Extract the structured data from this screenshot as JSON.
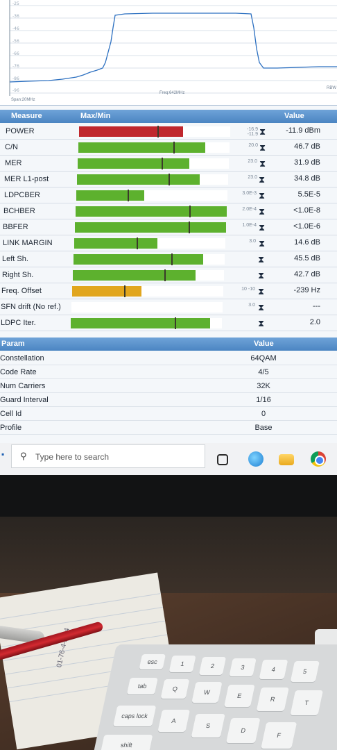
{
  "spectrum": {
    "db_ticks": [
      "-25",
      "-36",
      "-46",
      "-56",
      "-66",
      "-76",
      "-86",
      "-96"
    ],
    "span": "Span:20MHz",
    "freq": "Freq:642MHz",
    "rbw": "RBW"
  },
  "measure_header": {
    "measure": "Measure",
    "maxmin": "Max/Min",
    "value": "Value"
  },
  "measurements": [
    {
      "label": "POWER",
      "threshold": "-16.9\n-11.9",
      "value": "-11.9 dBm",
      "fill": 0.69,
      "color": "#c0272d",
      "color_name": "red"
    },
    {
      "label": "C/N",
      "threshold": "20.0",
      "value": "46.7 dB",
      "fill": 0.84,
      "color": "#5db12e",
      "color_name": "green"
    },
    {
      "label": "MER",
      "threshold": "23.0",
      "value": "31.9 dB",
      "fill": 0.74,
      "color": "#5db12e",
      "color_name": "green"
    },
    {
      "label": "MER L1-post",
      "threshold": "23.0",
      "value": "34.8 dB",
      "fill": 0.81,
      "color": "#5db12e",
      "color_name": "green"
    },
    {
      "label": "LDPCBER",
      "threshold": "3.0E-3",
      "value": "5.5E-5",
      "fill": 0.45,
      "color": "#5db12e",
      "color_name": "green"
    },
    {
      "label": "BCHBER",
      "threshold": "2.0E-4",
      "value": "<1.0E-8",
      "fill": 1.0,
      "color": "#5db12e",
      "color_name": "green"
    },
    {
      "label": "BBFER",
      "threshold": "1.0E-4",
      "value": "<1.0E-6",
      "fill": 1.0,
      "color": "#5db12e",
      "color_name": "green"
    },
    {
      "label": "LINK MARGIN",
      "threshold": "3.0",
      "value": "14.6 dB",
      "fill": 0.55,
      "color": "#5db12e",
      "color_name": "green"
    },
    {
      "label": "Left Sh.",
      "threshold": "",
      "value": "45.5 dB",
      "fill": 0.86,
      "color": "#5db12e",
      "color_name": "green"
    },
    {
      "label": "Right Sh.",
      "threshold": "",
      "value": "42.7 dB",
      "fill": 0.81,
      "color": "#5db12e",
      "color_name": "green"
    },
    {
      "label": "Freq. Offset",
      "threshold": "10\n-10",
      "value": "-239 Hz",
      "fill": 0.46,
      "color": "#e1a61e",
      "color_name": "amber"
    },
    {
      "label": "SFN drift (No ref.)",
      "threshold": "3.0",
      "value": "---",
      "fill": 0.0,
      "color": "#ffffff",
      "color_name": "none"
    },
    {
      "label": "LDPC Iter.",
      "threshold": "",
      "value": "2.0",
      "fill": 0.92,
      "color": "#5db12e",
      "color_name": "green"
    }
  ],
  "param_header": {
    "param": "Param",
    "value": "Value"
  },
  "params": [
    {
      "label": "Constellation",
      "value": "64QAM"
    },
    {
      "label": "Code Rate",
      "value": "4/5"
    },
    {
      "label": "Num Carriers",
      "value": "32K"
    },
    {
      "label": "Guard Interval",
      "value": "1/16"
    },
    {
      "label": "Cell Id",
      "value": "0"
    },
    {
      "label": "Profile",
      "value": "Base"
    }
  ],
  "taskbar": {
    "search_placeholder": "Type here to search",
    "icons": [
      "windows-start-icon",
      "search-icon",
      "task-view-icon",
      "edge-icon",
      "file-explorer-icon",
      "chrome-icon"
    ]
  },
  "desk": {
    "handnote": "01-76-4-2-24",
    "keys_row1": [
      "esc",
      "1",
      "2",
      "3",
      "4",
      "5"
    ],
    "keys_row2": [
      "tab",
      "Q",
      "W",
      "E",
      "R",
      "T"
    ],
    "keys_row3": [
      "caps lock",
      "A",
      "S",
      "D",
      "F"
    ],
    "keys_row4": [
      "shift"
    ]
  }
}
